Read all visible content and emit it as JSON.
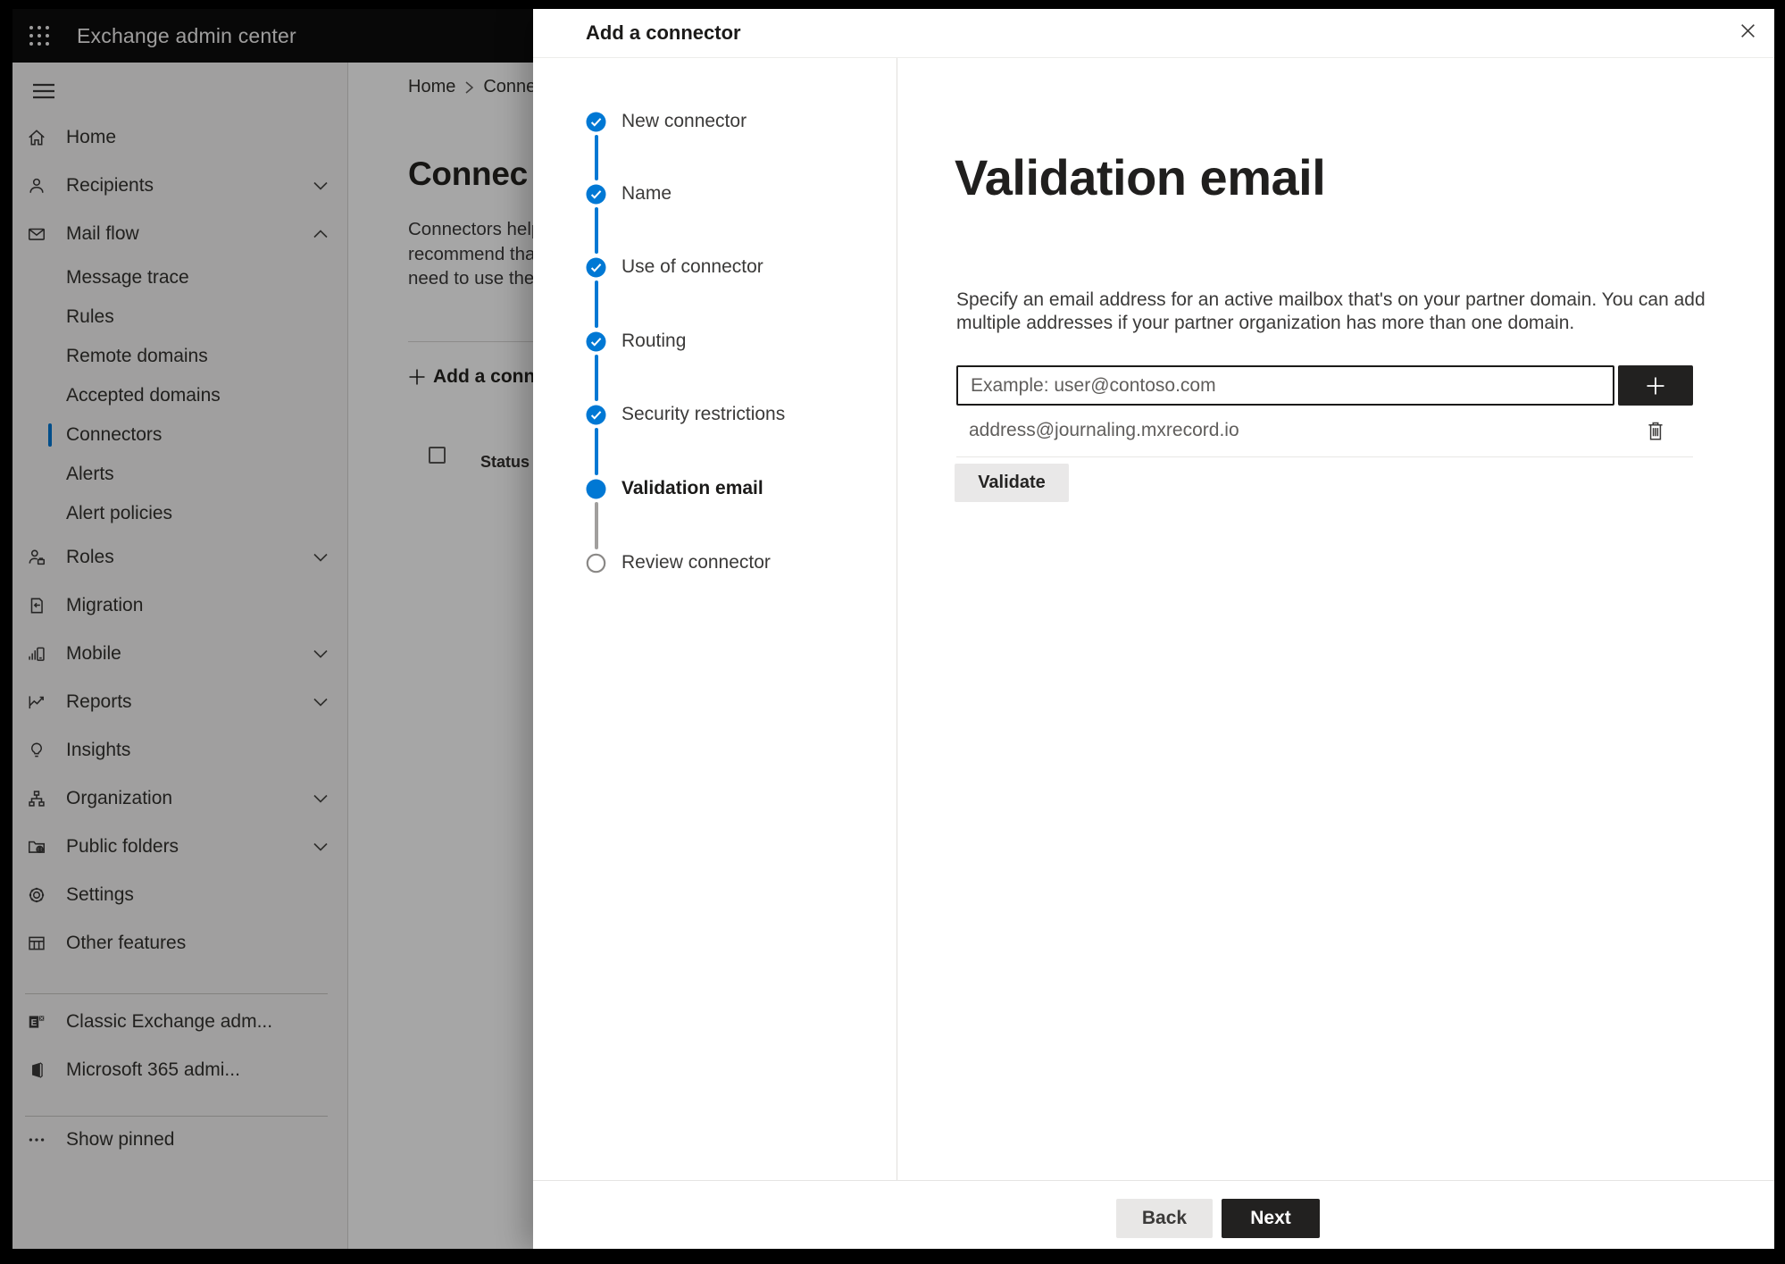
{
  "topbar": {
    "title": "Exchange admin center"
  },
  "sidebar": {
    "items": [
      {
        "label": "Home"
      },
      {
        "label": "Recipients"
      },
      {
        "label": "Mail flow"
      },
      {
        "label": "Message trace"
      },
      {
        "label": "Rules"
      },
      {
        "label": "Remote domains"
      },
      {
        "label": "Accepted domains"
      },
      {
        "label": "Connectors",
        "selected": true
      },
      {
        "label": "Alerts"
      },
      {
        "label": "Alert policies"
      },
      {
        "label": "Roles"
      },
      {
        "label": "Migration"
      },
      {
        "label": "Mobile"
      },
      {
        "label": "Reports"
      },
      {
        "label": "Insights"
      },
      {
        "label": "Organization"
      },
      {
        "label": "Public folders"
      },
      {
        "label": "Settings"
      },
      {
        "label": "Other features"
      },
      {
        "label": "Classic Exchange adm..."
      },
      {
        "label": "Microsoft 365 admi..."
      },
      {
        "label": "Show pinned"
      }
    ]
  },
  "page": {
    "breadcrumb": {
      "home": "Home",
      "current": "Conne"
    },
    "title": "Connec",
    "description_lines": [
      "Connectors help",
      "recommend that",
      "need to use ther"
    ],
    "add_button_label": "Add a conn",
    "table_header_status": "Status"
  },
  "wizard": {
    "title": "Add a connector",
    "steps": [
      {
        "label": "New connector",
        "state": "completed"
      },
      {
        "label": "Name",
        "state": "completed"
      },
      {
        "label": "Use of connector",
        "state": "completed"
      },
      {
        "label": "Routing",
        "state": "completed"
      },
      {
        "label": "Security restrictions",
        "state": "completed"
      },
      {
        "label": "Validation email",
        "state": "current"
      },
      {
        "label": "Review connector",
        "state": "upcoming"
      }
    ],
    "heading": "Validation email",
    "description_lines": [
      "Specify an email address for an active mailbox that's on your partner domain. You can add",
      "multiple addresses if your partner organization has more than one domain."
    ],
    "email_placeholder": "Example: user@contoso.com",
    "addresses": [
      "address@journaling.mxrecord.io"
    ],
    "validate_label": "Validate",
    "back_label": "Back",
    "next_label": "Next"
  },
  "colors": {
    "accent": "#0078d4",
    "dark_button": "#222120",
    "step_gray": "#a19f9d"
  }
}
